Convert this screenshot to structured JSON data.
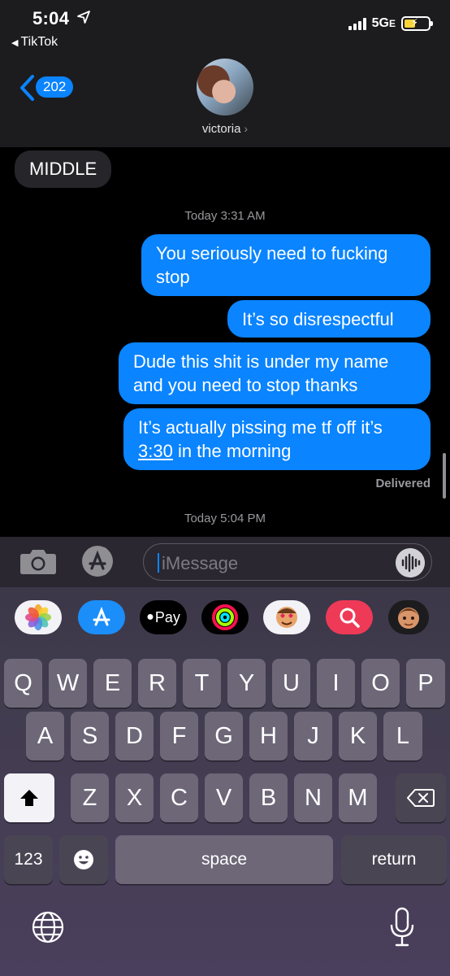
{
  "status": {
    "time": "5:04",
    "back_app": "TikTok",
    "network": "5G",
    "network_suffix": "E"
  },
  "header": {
    "unread_count": "202",
    "contact_name": "victoria"
  },
  "chat": {
    "incoming": [
      {
        "text": "MIDDLE"
      }
    ],
    "timestamp1": "Today 3:31 AM",
    "outgoing": [
      {
        "line1": "You seriously need to fucking",
        "line2": "stop"
      },
      {
        "line1": "It’s so disrespectful"
      },
      {
        "line1": "Dude this shit is under my name",
        "line2": "and you need to stop thanks"
      },
      {
        "line1": "It’s actually pissing me tf off it’s",
        "line2_link": "3:30",
        "line2_rest": " in the morning"
      }
    ],
    "delivered": "Delivered",
    "timestamp2": "Today 5:04 PM"
  },
  "input": {
    "placeholder": "iMessage"
  },
  "app_drawer": {
    "items": [
      "photos-icon",
      "app-store-icon",
      "apple-pay-icon",
      "activity-icon",
      "memoji-stickers-icon",
      "web-search-icon",
      "memoji-icon"
    ],
    "apple_pay_label": "Pay"
  },
  "keyboard": {
    "row1": [
      "Q",
      "W",
      "E",
      "R",
      "T",
      "Y",
      "U",
      "I",
      "O",
      "P"
    ],
    "row2": [
      "A",
      "S",
      "D",
      "F",
      "G",
      "H",
      "J",
      "K",
      "L"
    ],
    "row3": [
      "Z",
      "X",
      "C",
      "V",
      "B",
      "N",
      "M"
    ],
    "numbers": "123",
    "space": "space",
    "return": "return"
  },
  "colors": {
    "accent": "#0a84ff",
    "incoming_bubble": "#26252a",
    "header_bg": "#1c1c1e"
  }
}
